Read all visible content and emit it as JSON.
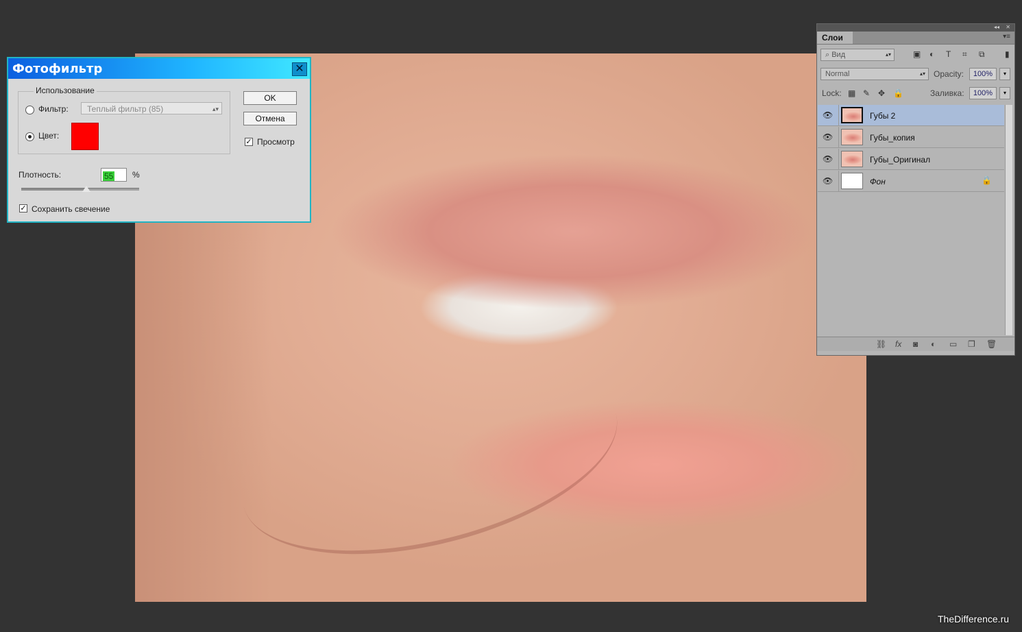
{
  "photo_filter": {
    "title": "Фотофильтр",
    "group_label": "Использование",
    "filter_label": "Фильтр:",
    "filter_value": "Теплый фильтр (85)",
    "color_label": "Цвет:",
    "color_swatch": "#ff0000",
    "ok_label": "OK",
    "cancel_label": "Отмена",
    "preview_label": "Просмотр",
    "preview_checked": true,
    "density_label": "Плотность:",
    "density_value": "55",
    "density_unit": "%",
    "density_fraction": 0.55,
    "preserve_label": "Сохранить свечение",
    "preserve_checked": true
  },
  "layers_panel": {
    "tab_label": "Слои",
    "search_placeholder": "Вид",
    "blend_mode": "Normal",
    "opacity_label": "Opacity:",
    "opacity_value": "100%",
    "lock_label": "Lock:",
    "fill_label": "Заливка:",
    "fill_value": "100%",
    "layers": [
      {
        "name": "Губы 2",
        "selected": true,
        "visible": true
      },
      {
        "name": "Губы_копия",
        "selected": false,
        "visible": true
      },
      {
        "name": "Губы_Оригинал",
        "selected": false,
        "visible": true
      },
      {
        "name": "Фон",
        "selected": false,
        "visible": true,
        "locked": true
      }
    ]
  },
  "watermark": "TheDifference.ru"
}
